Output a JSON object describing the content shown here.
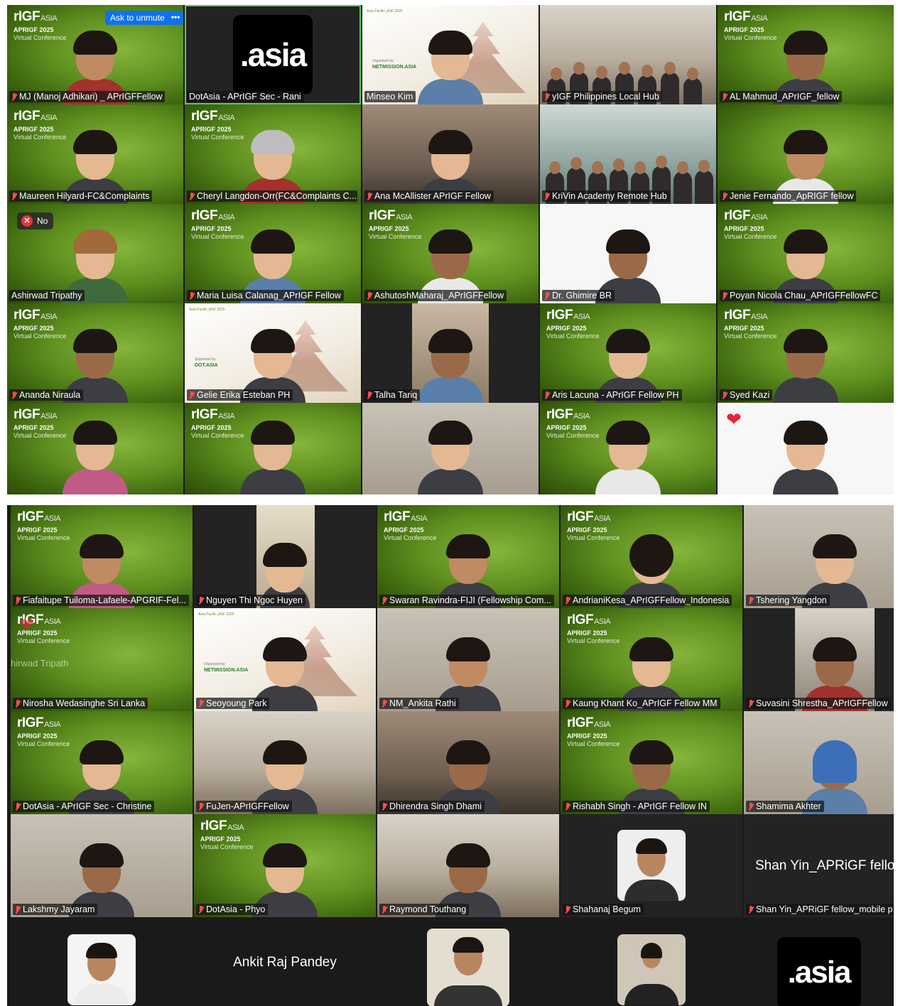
{
  "screenshot1": {
    "unmute_button": "Ask to unmute",
    "more_button": "•••",
    "no_reaction": "No",
    "brand": {
      "logo": "rIGF",
      "logo_suffix": "ASIA",
      "conference_line1": "APRIGF 2025",
      "conference_line2": "Virtual Conference",
      "url": "https://2025.aprigf.asia"
    },
    "asia_logo": ".asia",
    "slide": {
      "header": "Asia Pacific yIGF 2025",
      "organised_by": "Organised by",
      "netmission": "NETMISSION.ASIA",
      "supported_by": "Supported by",
      "sponsor": "DOT.ASIA"
    },
    "tiles": [
      {
        "name": "MJ (Manoj Adhikari) _ APrIGFFellow",
        "muted": true
      },
      {
        "name": "DotAsia - APrIGF Sec - Rani",
        "muted": false
      },
      {
        "name": "Minseo Kim",
        "muted": false
      },
      {
        "name": "yIGF Philippines Local Hub",
        "muted": true
      },
      {
        "name": "AL Mahmud_APrIGF_fellow",
        "muted": true
      },
      {
        "name": "Maureen Hilyard-FC&Complaints",
        "muted": true
      },
      {
        "name": "Cheryl Langdon-Orr(FC&Complaints C...",
        "muted": true
      },
      {
        "name": "Ana McAllister APrIGF Fellow",
        "muted": true
      },
      {
        "name": "KriVin Academy Remote Hub",
        "muted": true
      },
      {
        "name": "Jenie Fernando_ApRIGF fellow",
        "muted": true
      },
      {
        "name": "Ashirwad Tripathy",
        "muted": false
      },
      {
        "name": "Maria Luisa Calanag_APrIGF Fellow",
        "muted": true
      },
      {
        "name": "AshutoshMaharaj_APrIGFFellow",
        "muted": true
      },
      {
        "name": "Dr. Ghimire BR",
        "muted": true
      },
      {
        "name": "Poyan Nicola Chau_APrIGFFellowFC",
        "muted": true
      },
      {
        "name": "Ananda Niraula",
        "muted": true
      },
      {
        "name": "Gelie Erika Esteban PH",
        "muted": true
      },
      {
        "name": "Talha Tariq",
        "muted": true
      },
      {
        "name": "Aris Lacuna - APrIGF Fellow PH",
        "muted": true
      },
      {
        "name": "Syed Kazi",
        "muted": true
      }
    ]
  },
  "screenshot2": {
    "tiles": [
      {
        "name": "Fiafaitupe Tuiloma-Lafaele-APGRIF-Fel...",
        "muted": true
      },
      {
        "name": "Nguyen Thi Ngoc Huyen",
        "muted": true
      },
      {
        "name": "Swaran Ravindra-FIJI (Fellowship Com...",
        "muted": true
      },
      {
        "name": "AndrianiKesa_APrIGFFellow_Indonesia",
        "muted": true
      },
      {
        "name": "Tshering Yangdon",
        "muted": true
      },
      {
        "name": "Nirosha Wedasinghe Sri Lanka",
        "muted": true
      },
      {
        "name": "Seoyoung Park",
        "muted": true
      },
      {
        "name": "NM_Ankita Rathi",
        "muted": true
      },
      {
        "name": "Kaung Khant Ko_APrIGF Fellow MM",
        "muted": true
      },
      {
        "name": "Suvasini Shrestha_APrIGFFellow",
        "muted": true
      },
      {
        "name": "DotAsia - APrIGF Sec - Christine",
        "muted": true
      },
      {
        "name": "FuJen-APrIGFFellow",
        "muted": true
      },
      {
        "name": "Dhirendra Singh Dhami",
        "muted": true
      },
      {
        "name": "Rishabh Singh - APrIGF Fellow IN",
        "muted": true
      },
      {
        "name": "Shamima Akhter",
        "muted": true
      },
      {
        "name": "Lakshmy Jayaram",
        "muted": true
      },
      {
        "name": "DotAsia - Phyo",
        "muted": true
      },
      {
        "name": "Raymond Touthang",
        "muted": true
      },
      {
        "name": "Shahanaj  Begum",
        "muted": true
      },
      {
        "name": "Shan Yin_APRiGF fellow_mobile p",
        "muted": true
      }
    ],
    "shan_yin_overlay": "Shan Yin_APRiGF fello",
    "ghost_name": "hirwad Tripath",
    "bottom_strip_name": "Ankit Raj Pandey",
    "asia_logo": ".asia"
  }
}
